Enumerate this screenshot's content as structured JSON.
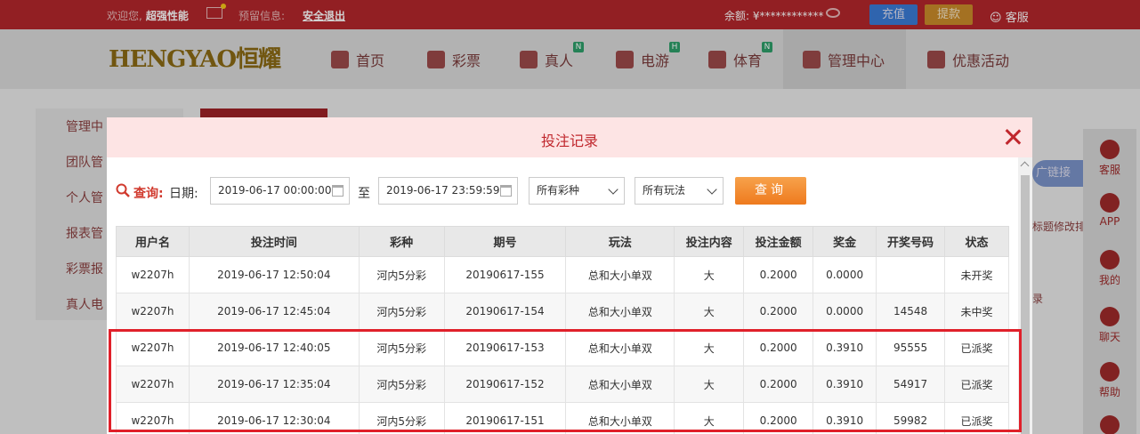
{
  "topbar": {
    "welcome": "欢迎您,",
    "username": "超强性能",
    "notice_label": "预留信息:",
    "logout": "安全退出",
    "balance": "余额: ¥************",
    "deposit": "充值",
    "withdraw": "提款",
    "service": "客服"
  },
  "nav": {
    "logo": "HENGYAO恒耀",
    "items": [
      {
        "label": "首页"
      },
      {
        "label": "彩票"
      },
      {
        "label": "真人",
        "badge": "N"
      },
      {
        "label": "电游",
        "badge": "H"
      },
      {
        "label": "体育",
        "badge": "N"
      },
      {
        "label": "管理中心"
      },
      {
        "label": "优惠活动"
      }
    ]
  },
  "background": {
    "menu": [
      "管理中",
      "团队管",
      "个人管",
      "报表管",
      "彩票报",
      "真人电"
    ],
    "promo_link": "广链接",
    "side_text_1": "标题修改排",
    "side_text_2": "录"
  },
  "right_float": [
    "客服",
    "APP",
    "我的",
    "聊天",
    "帮助"
  ],
  "modal": {
    "title": "投注记录",
    "query_label": "查询:",
    "date_label": "日期:",
    "start_date": "2019-06-17 00:00:00",
    "to_label": "至",
    "end_date": "2019-06-17 23:59:59",
    "lottery_select": "所有彩种",
    "play_select": "所有玩法",
    "query_button": "查询"
  },
  "table": {
    "headers": [
      "用户名",
      "投注时间",
      "彩种",
      "期号",
      "玩法",
      "投注内容",
      "投注金额",
      "奖金",
      "开奖号码",
      "状态"
    ],
    "rows": [
      {
        "user": "w2207h",
        "time": "2019-06-17 12:50:04",
        "lottery": "河内5分彩",
        "issue": "20190617-155",
        "play": "总和大小单双",
        "content": "大",
        "amount": "0.2000",
        "prize": "0.0000",
        "number": "",
        "status": "未开奖",
        "status_type": "pending"
      },
      {
        "user": "w2207h",
        "time": "2019-06-17 12:45:04",
        "lottery": "河内5分彩",
        "issue": "20190617-154",
        "play": "总和大小单双",
        "content": "大",
        "amount": "0.2000",
        "prize": "0.0000",
        "number": "14548",
        "status": "未中奖",
        "status_type": "lost"
      },
      {
        "user": "w2207h",
        "time": "2019-06-17 12:40:05",
        "lottery": "河内5分彩",
        "issue": "20190617-153",
        "play": "总和大小单双",
        "content": "大",
        "amount": "0.2000",
        "prize": "0.3910",
        "number": "95555",
        "status": "已派奖",
        "status_type": "paid"
      },
      {
        "user": "w2207h",
        "time": "2019-06-17 12:35:04",
        "lottery": "河内5分彩",
        "issue": "20190617-152",
        "play": "总和大小单双",
        "content": "大",
        "amount": "0.2000",
        "prize": "0.3910",
        "number": "54917",
        "status": "已派奖",
        "status_type": "paid"
      },
      {
        "user": "w2207h",
        "time": "2019-06-17 12:30:04",
        "lottery": "河内5分彩",
        "issue": "20190617-151",
        "play": "总和大小单双",
        "content": "大",
        "amount": "0.2000",
        "prize": "0.3910",
        "number": "59982",
        "status": "已派奖",
        "status_type": "paid"
      }
    ]
  },
  "colors": {
    "brand_red": "#b3272b",
    "modal_header": "#fde4e4",
    "query_button": "#ee7a1e",
    "highlight_border": "#e0202a"
  }
}
